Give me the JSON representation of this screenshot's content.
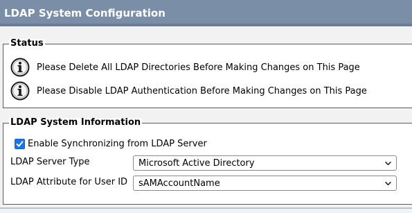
{
  "header": {
    "title": "LDAP System Configuration"
  },
  "status": {
    "legend": "Status",
    "messages": [
      {
        "icon": "info-icon",
        "text": "Please Delete All LDAP Directories Before Making Changes on This Page"
      },
      {
        "icon": "info-icon",
        "text": "Please Disable LDAP Authentication Before Making Changes on This Page"
      }
    ]
  },
  "system_info": {
    "legend": "LDAP System Information",
    "enable_sync": {
      "label": "Enable Synchronizing from LDAP Server",
      "checked": true
    },
    "server_type": {
      "label": "LDAP Server Type",
      "value": "Microsoft Active Directory"
    },
    "user_id_attr": {
      "label": "LDAP Attribute for User ID",
      "value": "sAMAccountName"
    }
  },
  "colors": {
    "title_bar": "#7b8ea8",
    "checkbox_accent": "#1a73e8"
  }
}
